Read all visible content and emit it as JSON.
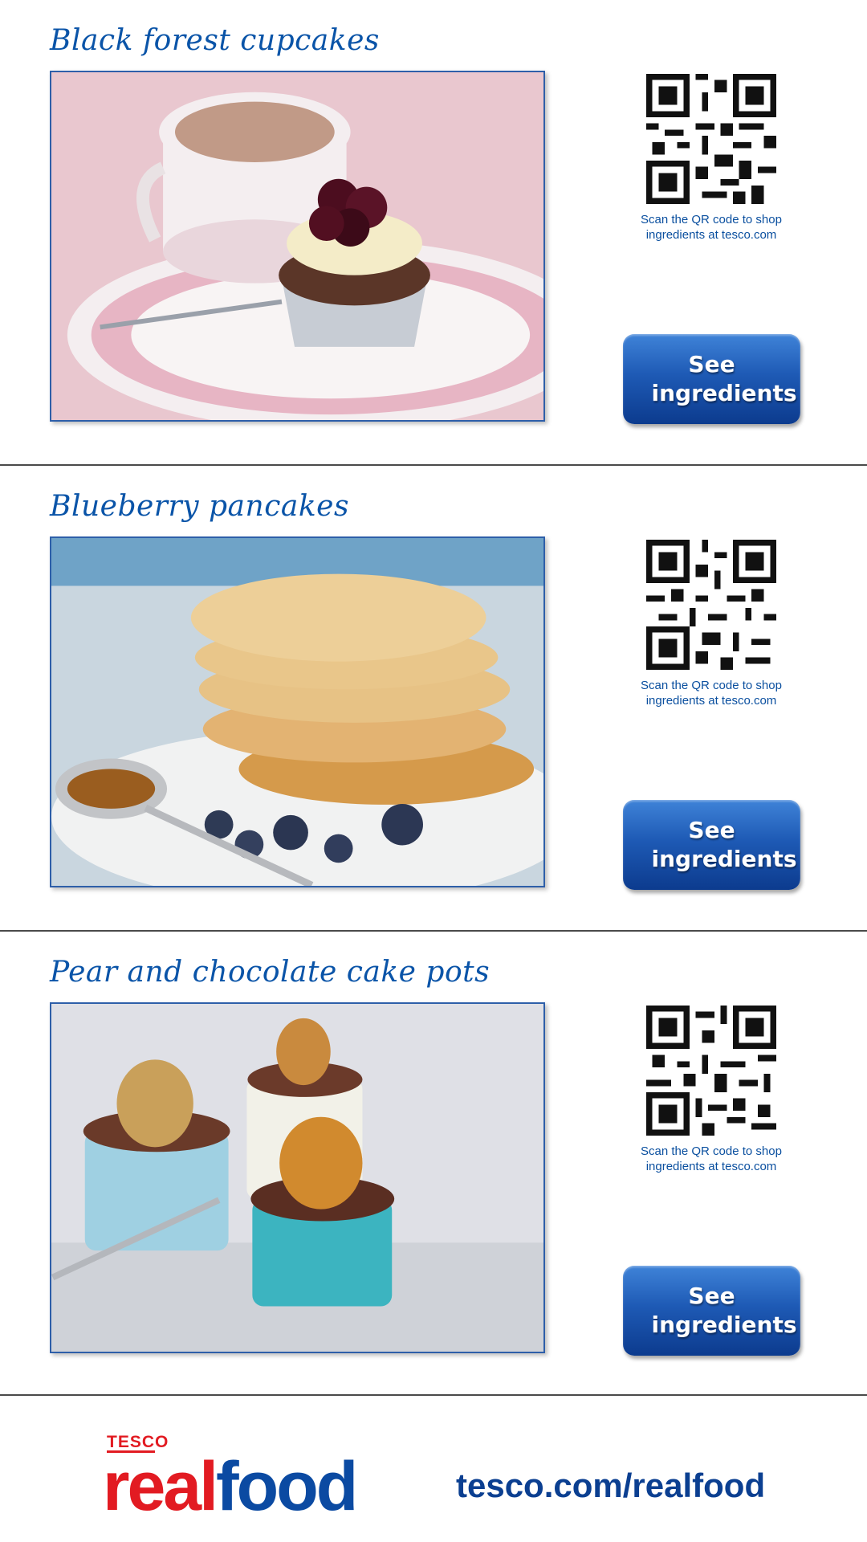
{
  "recipes": [
    {
      "title": "Black forest cupcakes",
      "qr_caption": "Scan the QR code to shop ingredients at tesco.com",
      "button_label": "See ingredients",
      "image": "black-forest-cupcake-with-tea-cup"
    },
    {
      "title": "Blueberry pancakes",
      "qr_caption": "Scan the QR code to shop ingredients at tesco.com",
      "button_label": "See ingredients",
      "image": "stack-of-blueberry-pancakes-with-syrup"
    },
    {
      "title": "Pear and chocolate cake pots",
      "qr_caption": "Scan the QR code to shop ingredients at tesco.com",
      "button_label": "See ingredients",
      "image": "pear-chocolate-cake-pots-in-ramekins"
    }
  ],
  "footer": {
    "logo_brand": "TESCO",
    "logo_real": "real",
    "logo_food": "food",
    "url": "tesco.com/realfood"
  },
  "colors": {
    "title_blue": "#0a54a8",
    "button_blue": "#1e5ab5",
    "tesco_red": "#e21b22",
    "tesco_blue": "#0b4aa2"
  }
}
